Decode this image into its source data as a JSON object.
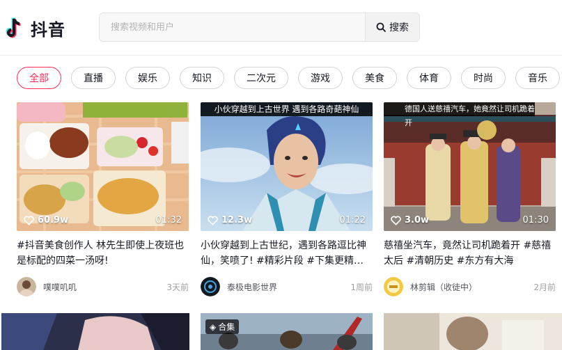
{
  "app": {
    "name": "抖音"
  },
  "search": {
    "placeholder": "搜索视频和用户",
    "button_label": "搜索"
  },
  "tabs": [
    {
      "label": "全部",
      "active": true
    },
    {
      "label": "直播"
    },
    {
      "label": "娱乐"
    },
    {
      "label": "知识"
    },
    {
      "label": "二次元"
    },
    {
      "label": "游戏"
    },
    {
      "label": "美食"
    },
    {
      "label": "体育"
    },
    {
      "label": "时尚"
    },
    {
      "label": "音乐"
    }
  ],
  "videos": [
    {
      "likes": "60.9w",
      "duration": "01:32",
      "overlay_title": "",
      "description": "#抖音美食创作人 林先生即使上夜班也是标配的四菜一汤呀!",
      "author": "噗噗叽叽",
      "time": "3天前"
    },
    {
      "likes": "12.3w",
      "duration": "01:22",
      "overlay_title": "小伙穿越到上古世界 遇到各路奇葩神仙",
      "description": "小伙穿越到上古世纪，遇到各路逗比神仙，笑喷了! #精彩片段 #下集更精…",
      "author": "泰极电影世界",
      "time": "1周前"
    },
    {
      "likes": "3.0w",
      "duration": "01:30",
      "overlay_title": "德国人送慈禧汽车，她竟然让司机跪着开",
      "description": "慈禧坐汽车，竟然让司机跪着开 #慈禧太后 #清朝历史 #东方有大海",
      "author": "林剪辑（收徒中）",
      "time": "2月前"
    }
  ],
  "row2_badges": [
    "合集"
  ],
  "colors": {
    "accent": "#fe2c55",
    "text": "#161823",
    "muted": "#a0a0a3"
  }
}
